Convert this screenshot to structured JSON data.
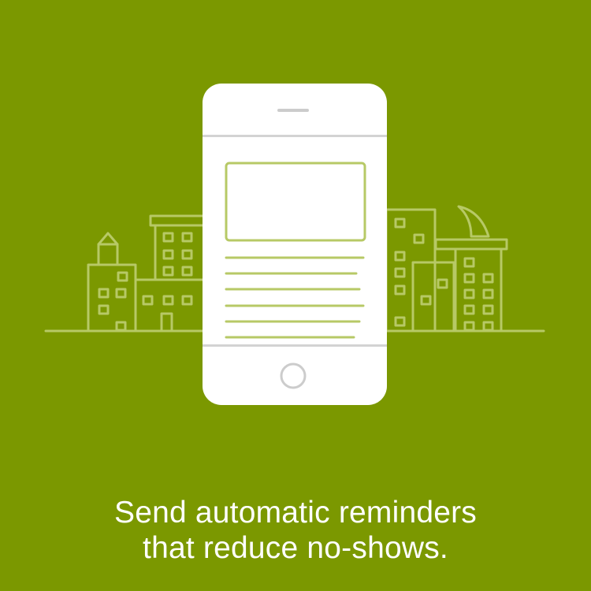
{
  "colors": {
    "background": "#7b9800",
    "illustration_line": "#b7c966",
    "phone_body": "#ffffff",
    "phone_separator": "#d3d3d3",
    "caption_text": "#ffffff"
  },
  "illustration": {
    "icons": [
      "city-skyline-icon",
      "smartphone-icon",
      "home-button-icon"
    ]
  },
  "caption": {
    "line1": "Send automatic reminders",
    "line2": "that reduce no-shows."
  }
}
